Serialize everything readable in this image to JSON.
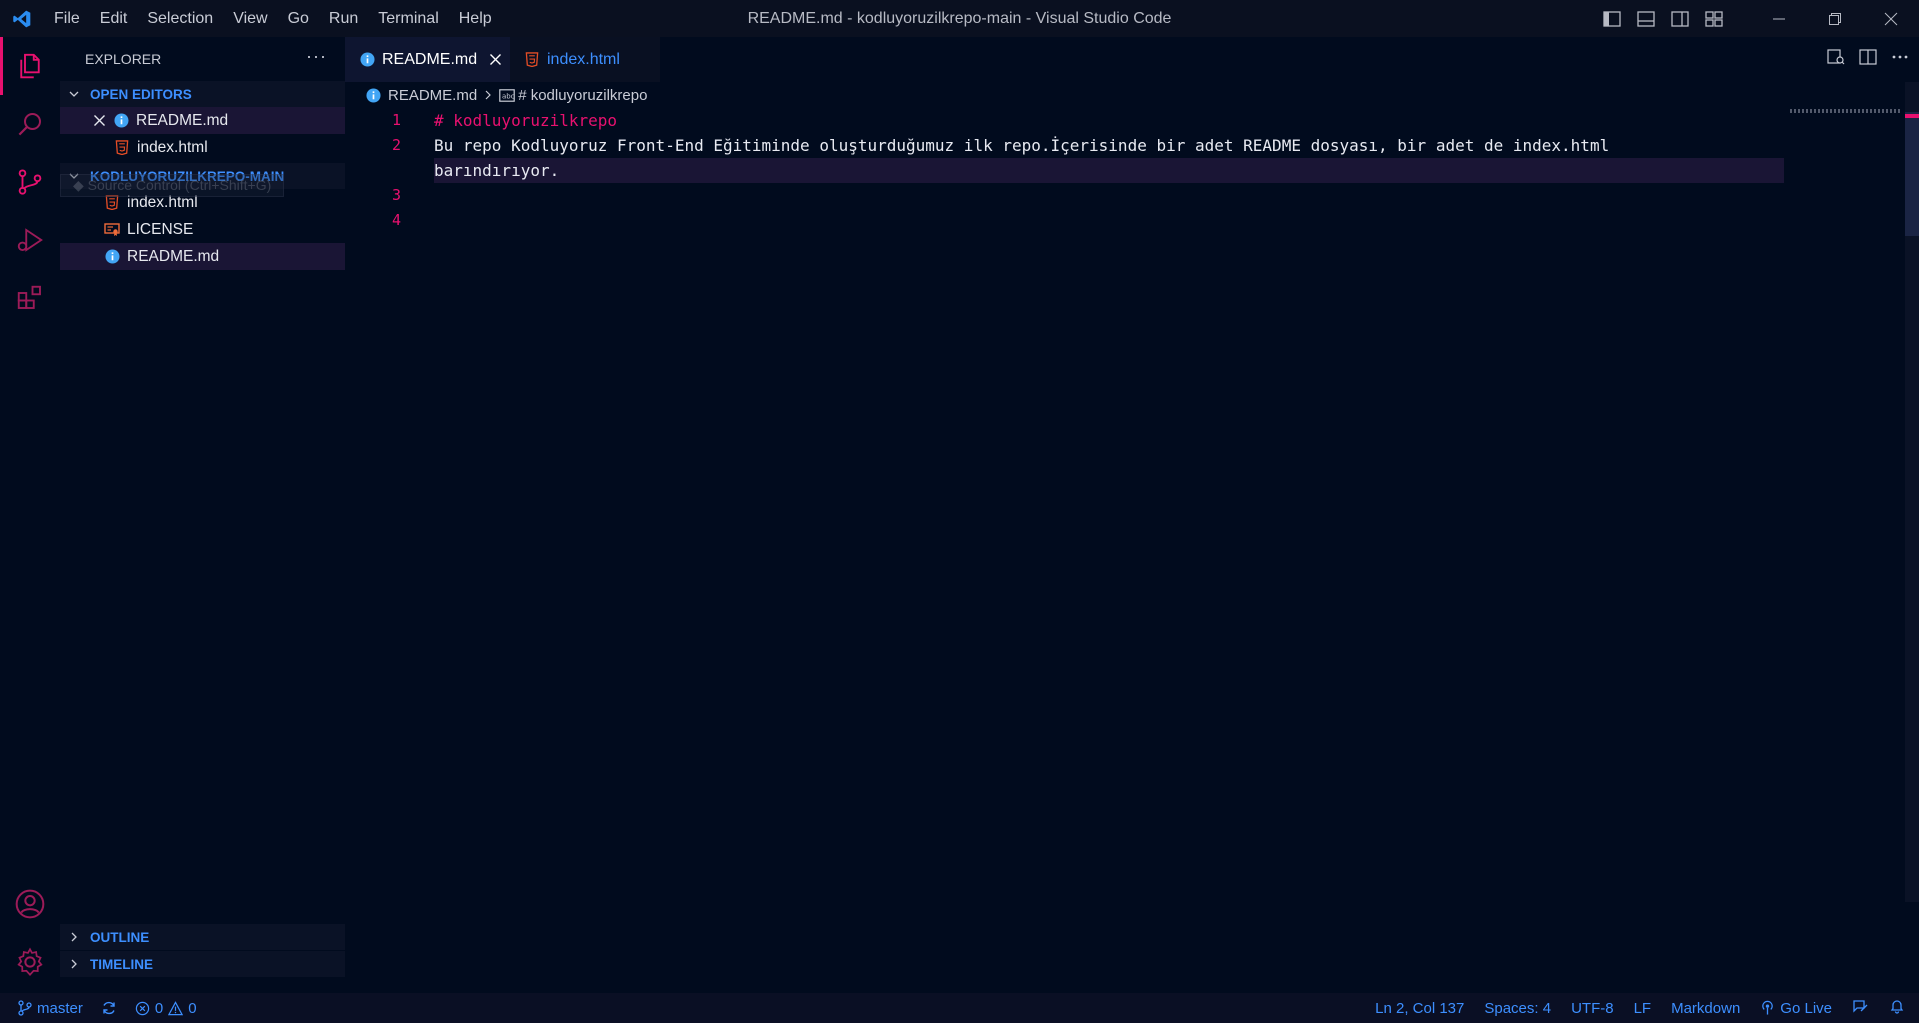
{
  "window": {
    "title": "README.md - kodluyoruzilkrepo-main - Visual Studio Code"
  },
  "menu": [
    "File",
    "Edit",
    "Selection",
    "View",
    "Go",
    "Run",
    "Terminal",
    "Help"
  ],
  "sidebar": {
    "title": "EXPLORER",
    "more": "···",
    "open_editors_label": "OPEN EDITORS",
    "open_editors": [
      "README.md",
      "index.html"
    ],
    "folder_label": "KODLUYORUZILKREPO-MAIN",
    "files": [
      "index.html",
      "LICENSE",
      "README.md"
    ],
    "tooltip": "Source Control (Ctrl+Shift+G)",
    "outline_label": "OUTLINE",
    "timeline_label": "TIMELINE"
  },
  "tabs": [
    {
      "label": "README.md",
      "active": true
    },
    {
      "label": "index.html",
      "active": false
    }
  ],
  "breadcrumb": {
    "file": "README.md",
    "symbol": "# kodluyoruzilkrepo"
  },
  "editor": {
    "line_numbers": [
      "1",
      "2",
      "3",
      "4"
    ],
    "lines": [
      "# kodluyoruzilkrepo",
      "Bu repo Kodluyoruz Front-End Eğitiminde oluşturduğumuz ilk repo.İçerisinde bir adet README dosyası, bir adet de index.html",
      "barındırıyor.",
      "",
      ""
    ]
  },
  "statusbar": {
    "branch": "master",
    "errors": "0",
    "warnings": "0",
    "position": "Ln 2, Col 137",
    "spaces": "Spaces: 4",
    "encoding": "UTF-8",
    "eol": "LF",
    "language": "Markdown",
    "golive": "Go Live"
  },
  "colors": {
    "accent": "#e8116f",
    "link": "#3d8fff",
    "background": "#010b1e",
    "html_icon": "#e44d26",
    "info_icon": "#42a5f5",
    "license_icon": "#ef6c3a"
  }
}
